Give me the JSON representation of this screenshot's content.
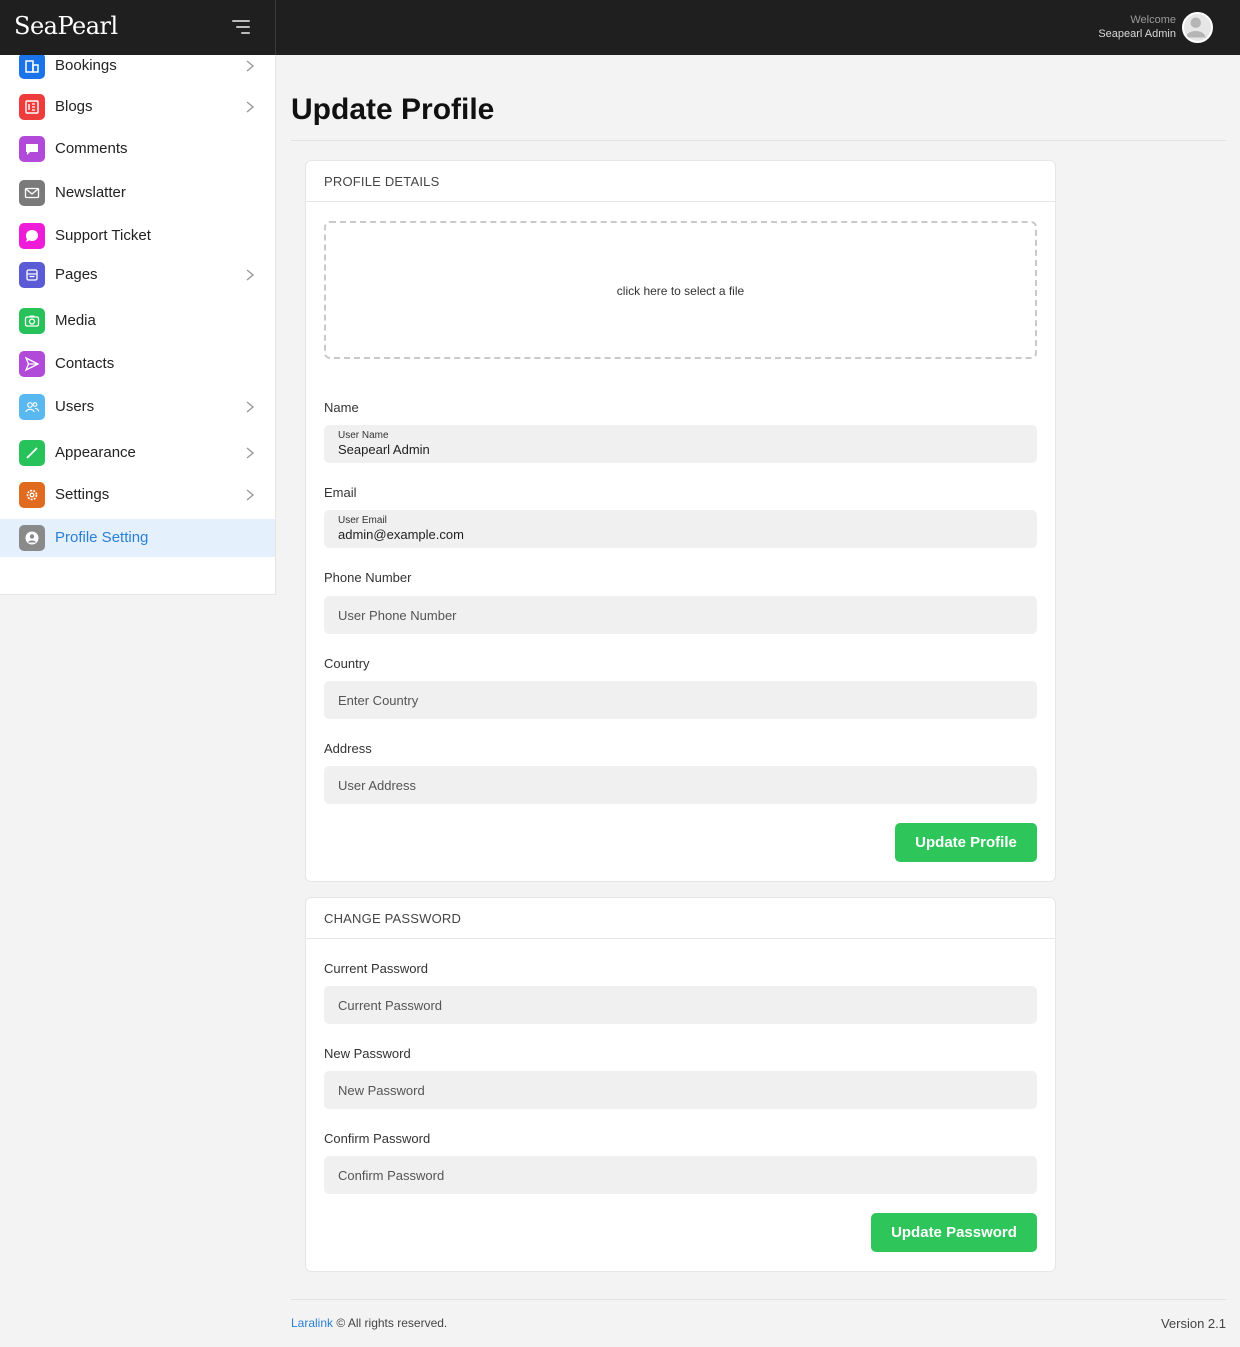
{
  "app": {
    "logo": "SeaPearl",
    "welcome_label": "Welcome",
    "user_name": "Seapearl Admin"
  },
  "sidebar": {
    "items": [
      {
        "label": "Bookings",
        "icon": "bookings-icon",
        "color": "#1a73e8",
        "has_children": true
      },
      {
        "label": "Blogs",
        "icon": "blog-icon",
        "color": "#ee3b3b",
        "has_children": true
      },
      {
        "label": "Comments",
        "icon": "comment-icon",
        "color": "#b24ad9",
        "has_children": false
      },
      {
        "label": "Newslatter",
        "icon": "mail-icon",
        "color": "#7a7a7a",
        "has_children": false
      },
      {
        "label": "Support Ticket",
        "icon": "chat-bubble-icon",
        "color": "#ee1bd8",
        "has_children": false
      },
      {
        "label": "Pages",
        "icon": "pages-icon",
        "color": "#5b5bd6",
        "has_children": true
      },
      {
        "label": "Media",
        "icon": "camera-icon",
        "color": "#27c25a",
        "has_children": false
      },
      {
        "label": "Contacts",
        "icon": "send-icon",
        "color": "#b24ad9",
        "has_children": false
      },
      {
        "label": "Users",
        "icon": "users-icon",
        "color": "#5ab8f0",
        "has_children": true
      },
      {
        "label": "Appearance",
        "icon": "brush-icon",
        "color": "#27c25a",
        "has_children": true
      },
      {
        "label": "Settings",
        "icon": "gear-icon",
        "color": "#e06a1f",
        "has_children": true
      },
      {
        "label": "Profile Setting",
        "icon": "user-circle-icon",
        "color": "#8a8a8a",
        "has_children": false,
        "active": true
      }
    ]
  },
  "main": {
    "title": "Update Profile",
    "profile_card": {
      "header": "PROFILE DETAILS",
      "dropzone_text": "click here to select a file",
      "name": {
        "label": "Name",
        "floating_label": "User Name",
        "value": "Seapearl Admin"
      },
      "email": {
        "label": "Email",
        "floating_label": "User Email",
        "value": "admin@example.com"
      },
      "phone": {
        "label": "Phone Number",
        "placeholder": "User Phone Number"
      },
      "country": {
        "label": "Country",
        "placeholder": "Enter Country"
      },
      "address": {
        "label": "Address",
        "placeholder": "User Address"
      },
      "submit_label": "Update Profile"
    },
    "password_card": {
      "header": "CHANGE PASSWORD",
      "current": {
        "label": "Current Password",
        "placeholder": "Current Password"
      },
      "new": {
        "label": "New Password",
        "placeholder": "New Password"
      },
      "confirm": {
        "label": "Confirm Password",
        "placeholder": "Confirm Password"
      },
      "submit_label": "Update Password"
    }
  },
  "footer": {
    "link_text": "Laralink",
    "rights_text": " © All rights reserved.",
    "version": "Version 2.1"
  }
}
